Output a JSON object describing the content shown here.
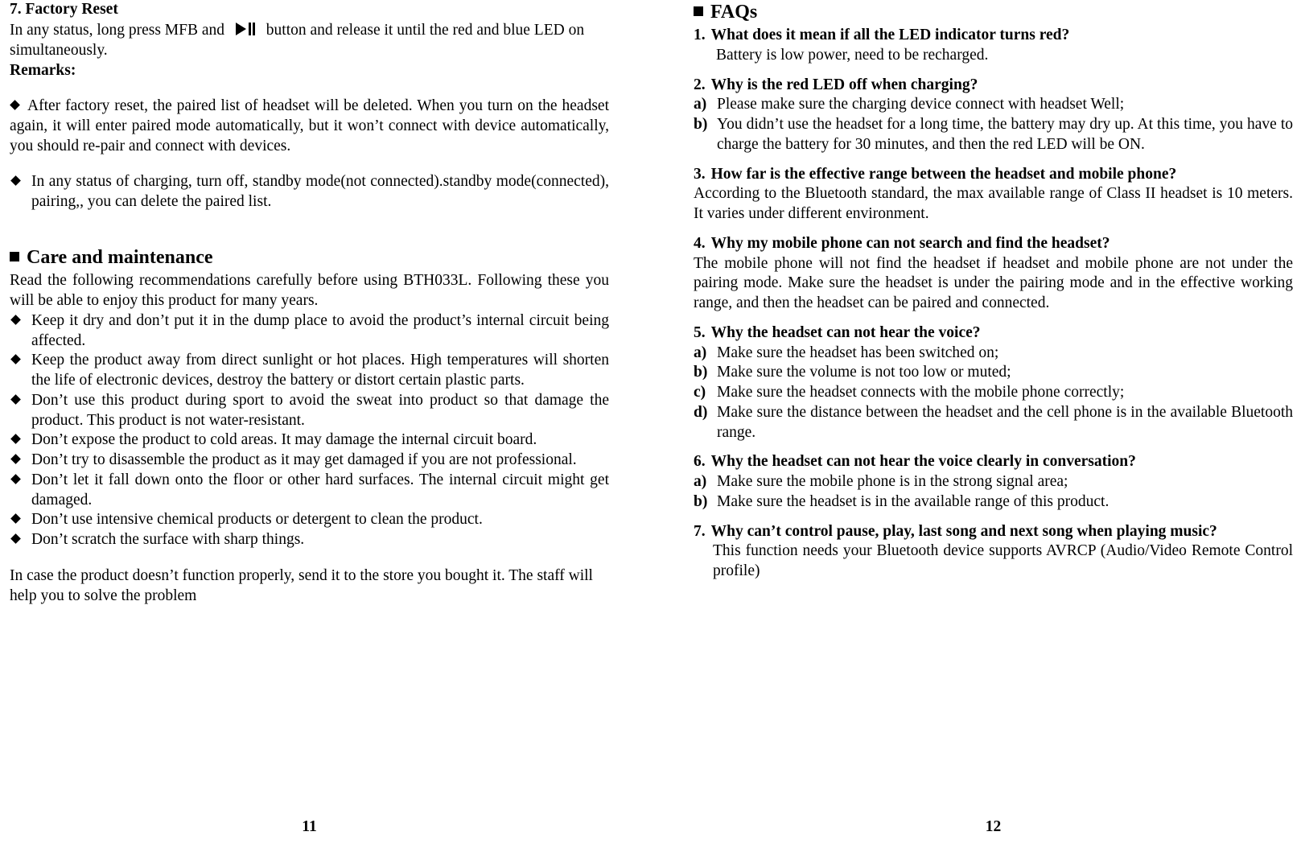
{
  "left_page": {
    "page_number": "11",
    "section7_title": "7. Factory Reset",
    "section7_text_before": "In any status, long press MFB and",
    "section7_icon": "play-pause-icon",
    "section7_text_after": "button and release it until the red and blue LED on simultaneously.",
    "remarks_label": "Remarks:",
    "remarks_items": [
      "After factory reset, the paired list of headset will be deleted. When you turn on the headset again, it will enter paired mode automatically, but it won’t connect with device automatically, you should re-pair and connect with devices.",
      "In any status of charging, turn off, standby mode(not connected).standby mode(connected), pairing,, you can delete the paired list."
    ],
    "care_title": "Care and maintenance",
    "care_intro": "Read the following recommendations carefully before using BTH033L. Following these you will be able to enjoy this product for many years.",
    "care_items": [
      "Keep it dry and don’t put it in the dump place to avoid the product’s internal circuit being affected.",
      "Keep the product away from direct sunlight or hot places. High temperatures will shorten the life of electronic devices, destroy the battery or distort certain plastic parts.",
      "Don’t use this product during sport to avoid the sweat into product so that damage the product. This product is not water-resistant.",
      "Don’t expose the product to cold areas. It may damage the internal circuit board.",
      "Don’t try to disassemble the product as it may get damaged if you are not professional.",
      "Don’t let it fall down onto the floor or other hard surfaces. The internal circuit might get damaged.",
      "Don’t use intensive chemical products or detergent to clean the product.",
      "Don’t scratch the surface with sharp things."
    ],
    "closing_text": "In case the product doesn’t function properly, send it to the store you bought it. The staff will help you to solve the problem"
  },
  "right_page": {
    "page_number": "12",
    "faq_title": "FAQs",
    "faqs": [
      {
        "num": "1.",
        "question": "What does it mean if all the LED indicator turns red?",
        "answers": [
          {
            "type": "plain",
            "text": "Battery is low power, need to be recharged."
          }
        ]
      },
      {
        "num": "2.",
        "question": "Why is the red LED off when charging?",
        "answers": [
          {
            "type": "lettered",
            "label": "a)",
            "text": "Please make sure the charging device connect with headset Well;"
          },
          {
            "type": "lettered",
            "label": "b)",
            "text": "You didn’t use the headset for a long time, the battery may dry up. At this time, you have to charge the battery for 30 minutes, and then the red LED will be ON."
          }
        ]
      },
      {
        "num": "3.",
        "question": "How far is the effective range between the headset and mobile phone?",
        "answers": [
          {
            "type": "block",
            "text": "According to the Bluetooth standard, the max available range of Class II headset is 10 meters. It varies under different environment."
          }
        ]
      },
      {
        "num": "4.",
        "question": "Why my mobile phone can not search and find the headset?",
        "answers": [
          {
            "type": "block",
            "text": "The mobile phone will not find the headset if headset and mobile phone are not under the pairing mode. Make sure the headset is under the pairing mode and in the effective working range, and then the headset can be paired and connected."
          }
        ]
      },
      {
        "num": "5.",
        "question": "Why the headset can not hear the voice?",
        "answers": [
          {
            "type": "lettered",
            "label": "a)",
            "text": "Make sure the headset has been switched on;"
          },
          {
            "type": "lettered",
            "label": "b)",
            "text": "Make sure the volume is not too low or muted;"
          },
          {
            "type": "lettered",
            "label": "c)",
            "text": "Make sure the headset connects with the mobile phone correctly;"
          },
          {
            "type": "lettered",
            "label": "d)",
            "text": "Make sure the distance between the headset and the cell phone is in the available Bluetooth range."
          }
        ]
      },
      {
        "num": "6.",
        "question": "Why the headset can not hear the voice clearly in conversation?",
        "answers": [
          {
            "type": "lettered",
            "label": "a)",
            "text": "Make sure the mobile phone is in the strong signal area;"
          },
          {
            "type": "lettered",
            "label": "b)",
            "text": "Make sure the headset is in the available range of this product."
          }
        ]
      },
      {
        "num": "7.",
        "question": "Why can’t control pause, play, last song and next song when playing music?",
        "answers": [
          {
            "type": "plain",
            "text": "This function needs your Bluetooth device supports AVRCP (Audio/Video Remote Control profile)"
          }
        ]
      }
    ]
  }
}
